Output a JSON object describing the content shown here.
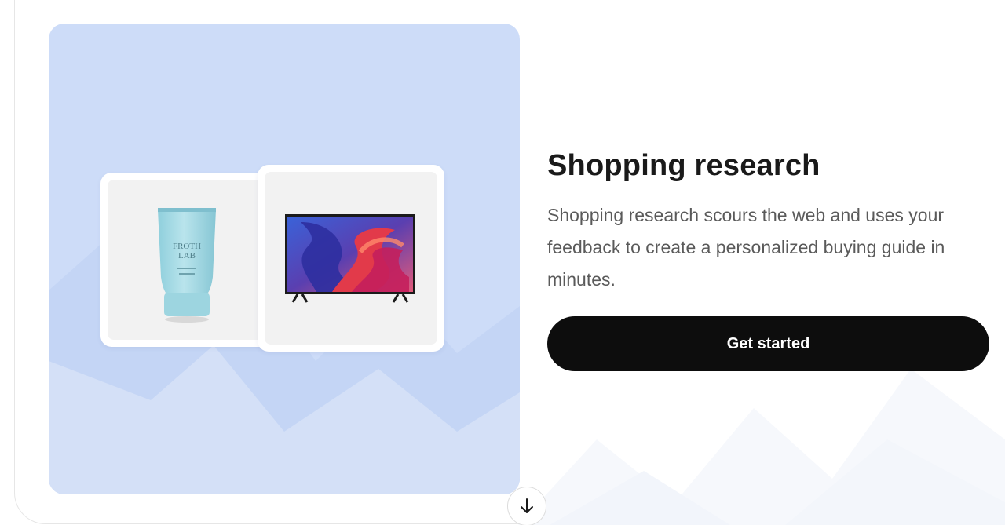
{
  "feature": {
    "title": "Shopping research",
    "description": "Shopping research scours the web and uses your feedback to create a personalized buying guide in minutes.",
    "cta_label": "Get started"
  },
  "hero": {
    "tube_brand": "FROTH LAB",
    "tube_brand_line1": "FROTH",
    "tube_brand_line2": "LAB"
  },
  "icons": {
    "scroll_down": "arrow-down-icon"
  },
  "colors": {
    "hero_background": "#cddcf8",
    "button_background": "#0d0d0d",
    "button_text": "#ffffff",
    "title_text": "#1a1a1a",
    "description_text": "#5a5a5a"
  }
}
